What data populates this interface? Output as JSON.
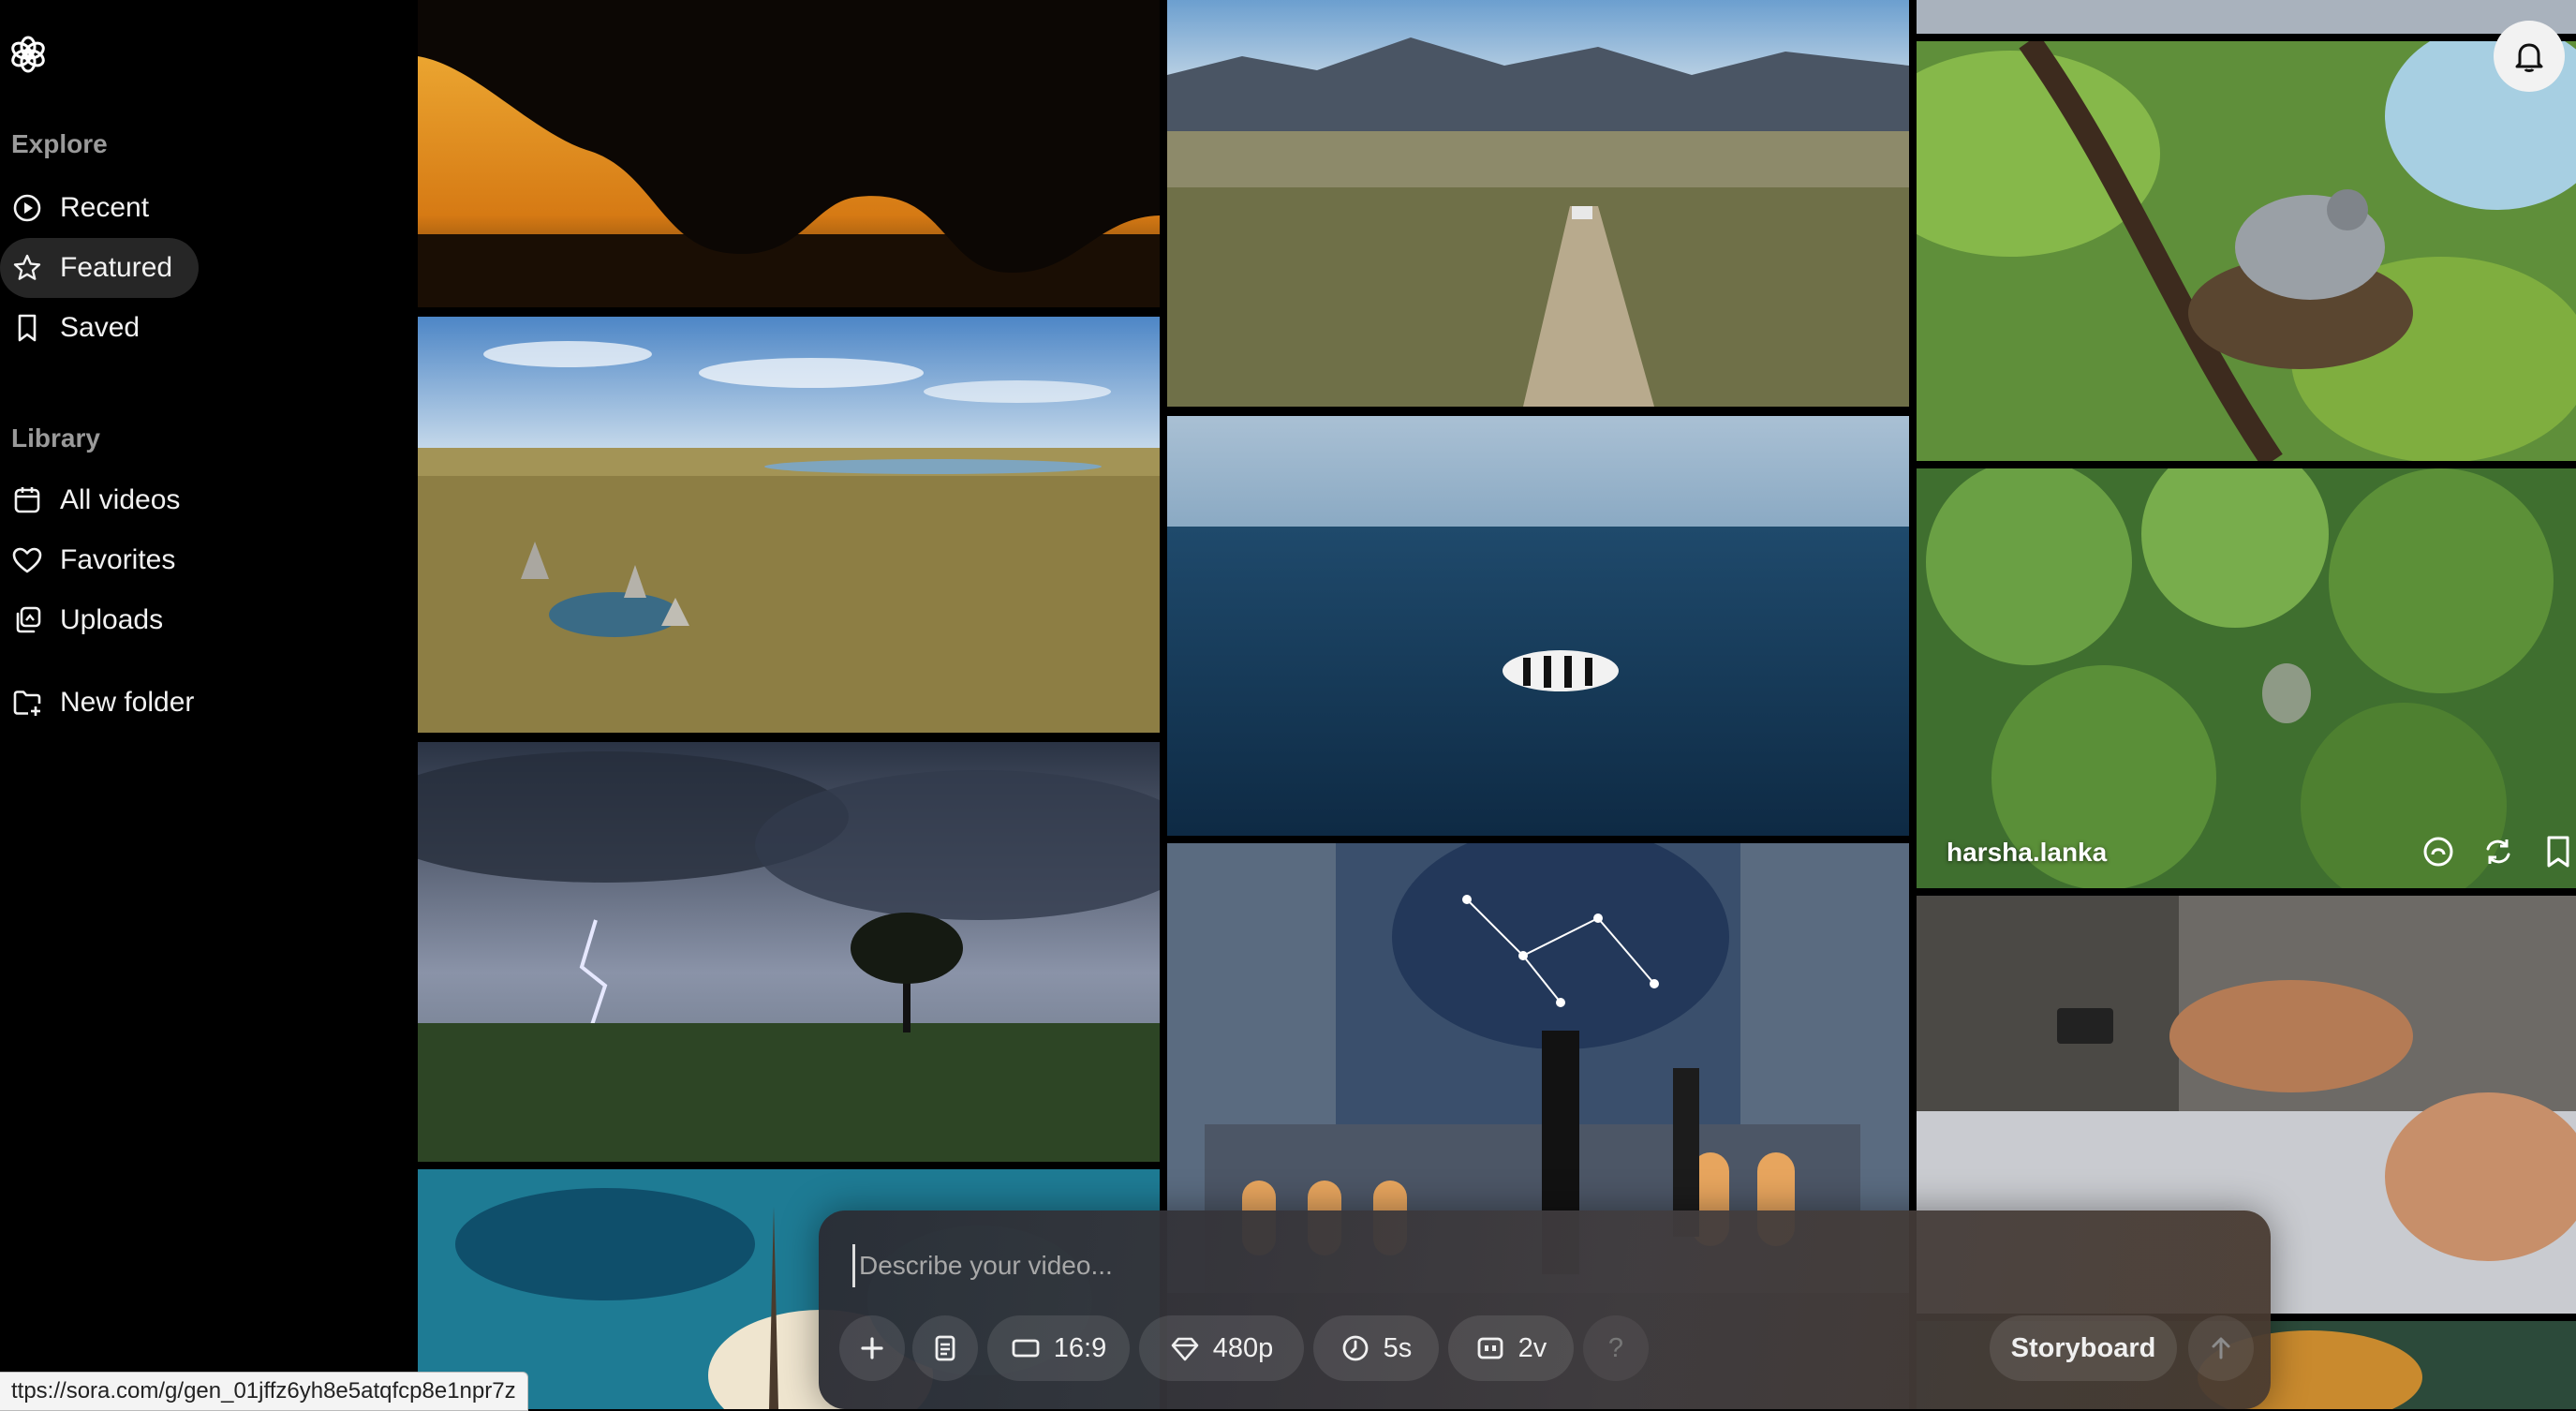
{
  "sidebar": {
    "explore_title": "Explore",
    "explore_items": [
      {
        "label": "Recent",
        "icon": "play-circle-icon"
      },
      {
        "label": "Featured",
        "icon": "star-icon",
        "active": true
      },
      {
        "label": "Saved",
        "icon": "bookmark-icon"
      }
    ],
    "library_title": "Library",
    "library_items": [
      {
        "label": "All videos",
        "icon": "calendar-grid-icon"
      },
      {
        "label": "Favorites",
        "icon": "heart-icon"
      },
      {
        "label": "Uploads",
        "icon": "uploads-icon"
      }
    ],
    "new_folder": {
      "label": "New folder",
      "icon": "new-folder-icon"
    }
  },
  "feed": {
    "hovered_author": "harsha.lanka",
    "tiles": [
      "rhino silhouette at sunset",
      "standing stones around a pond in grassland",
      "lightning storm over a lone tree",
      "tropical island with eiffel tower",
      "car on dirt road through desert valley",
      "zebra swimming in the ocean",
      "constellation dome over a colonnade",
      "bird sitting on a nest",
      "buddha statue in a forest",
      "woman sleeping in bed"
    ]
  },
  "composer": {
    "placeholder": "Describe your video...",
    "aspect_ratio": "16:9",
    "resolution": "480p",
    "duration": "5s",
    "variations": "2v",
    "help": "?",
    "storyboard_label": "Storyboard"
  },
  "status_url": "ttps://sora.com/g/gen_01jffz6yh8e5atqfcp8e1npr7z",
  "colors": {
    "background": "#000000",
    "active_nav": "#262626",
    "composer": "#34353c"
  }
}
